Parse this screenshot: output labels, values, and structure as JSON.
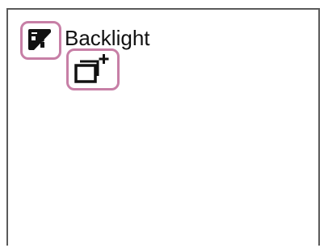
{
  "scene": {
    "label": "Backlight",
    "icon": "backlight-scene-icon"
  },
  "indicator": {
    "icon": "multi-frame-nr-icon"
  },
  "colors": {
    "highlight": "#c77fa6",
    "frame": "#5a5a5a",
    "text": "#111111"
  }
}
